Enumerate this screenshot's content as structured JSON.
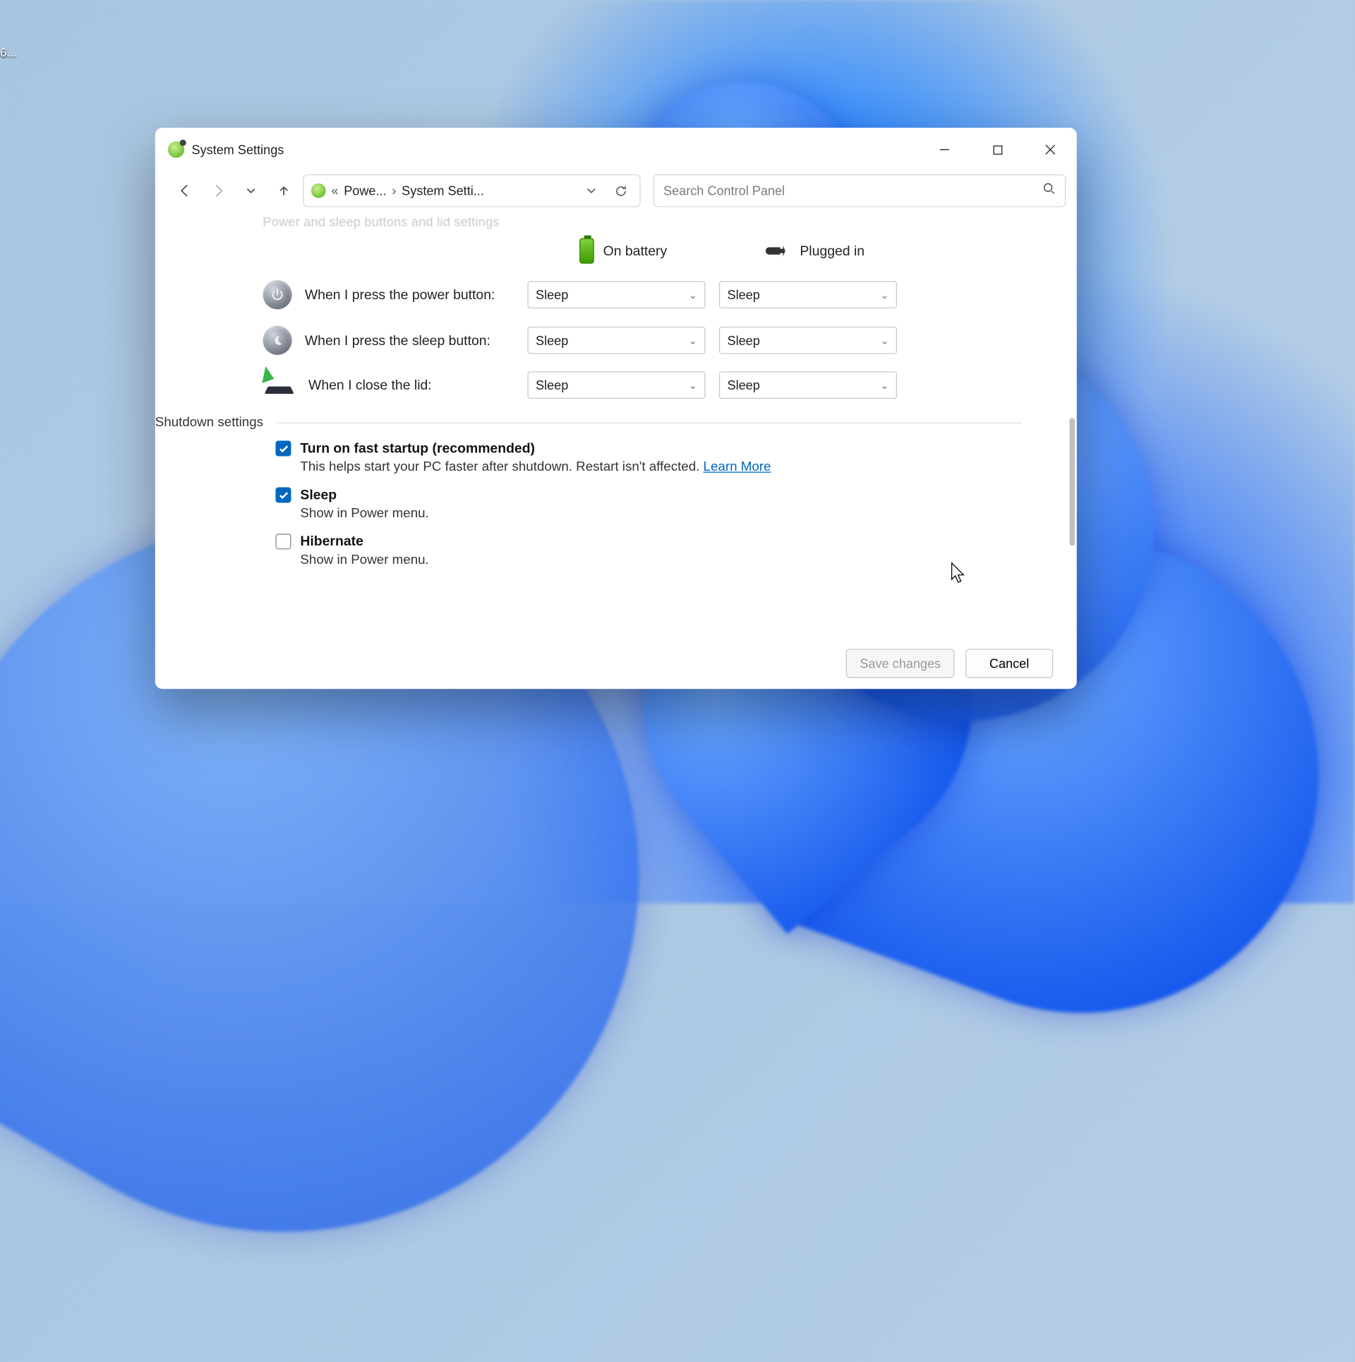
{
  "desktop": {
    "icon_label_fragment": "6..."
  },
  "window": {
    "title": "System Settings",
    "controls": {
      "minimize": "—",
      "maximize": "▢",
      "close": "✕"
    }
  },
  "nav": {
    "crumb_prefix": "«",
    "crumb1": "Powe...",
    "crumb_sep": "›",
    "crumb2": "System Setti...",
    "refresh": "⟳",
    "dropdown": "⌄"
  },
  "search": {
    "placeholder": "Search Control Panel"
  },
  "content": {
    "cut_heading": "Power and sleep buttons and lid settings",
    "col_battery": "On battery",
    "col_plugged": "Plugged in",
    "rows": {
      "power": {
        "label": "When I press the power button:",
        "battery": "Sleep",
        "plugged": "Sleep"
      },
      "sleep": {
        "label": "When I press the sleep button:",
        "battery": "Sleep",
        "plugged": "Sleep"
      },
      "lid": {
        "label": "When I close the lid:",
        "battery": "Sleep",
        "plugged": "Sleep"
      }
    },
    "shutdown_heading": "Shutdown settings",
    "fast": {
      "label": "Turn on fast startup (recommended)",
      "desc": "This helps start your PC faster after shutdown. Restart isn't affected. ",
      "link": "Learn More",
      "checked": true
    },
    "sleep_opt": {
      "label": "Sleep",
      "desc": "Show in Power menu.",
      "checked": true
    },
    "hibernate_opt": {
      "label": "Hibernate",
      "desc": "Show in Power menu.",
      "checked": false
    }
  },
  "footer": {
    "save": "Save changes",
    "cancel": "Cancel"
  }
}
